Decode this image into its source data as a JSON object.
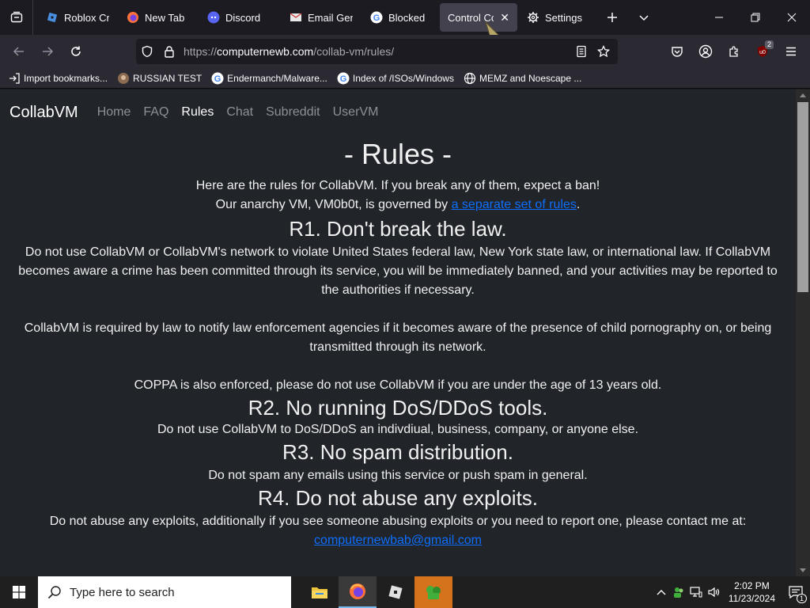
{
  "browser": {
    "tabs": [
      {
        "label": "Roblox Cre",
        "icon": "roblox-icon"
      },
      {
        "label": "New Tab",
        "icon": "firefox-icon"
      },
      {
        "label": "Discord",
        "icon": "discord-icon"
      },
      {
        "label": "Email Gene",
        "icon": "email-icon"
      },
      {
        "label": "Blocked",
        "icon": "google-icon"
      },
      {
        "label": "Control Co",
        "icon": "tab-icon",
        "active": true
      },
      {
        "label": "Settings",
        "icon": "gear-icon"
      }
    ],
    "url_prefix": "https://",
    "url_host": "computernewb.com",
    "url_path": "/collab-vm/rules/",
    "extension_badge": "2",
    "bookmarks": [
      {
        "label": "Import bookmarks...",
        "icon": "import-icon"
      },
      {
        "label": "RUSSIAN TEST",
        "icon": "bookmark-image-icon"
      },
      {
        "label": "Endermanch/Malware...",
        "icon": "google-icon"
      },
      {
        "label": "Index of /ISOs/Windows",
        "icon": "google-icon"
      },
      {
        "label": "MEMZ and Noescape ...",
        "icon": "globe-icon"
      }
    ]
  },
  "site": {
    "brand": "CollabVM",
    "nav": [
      "Home",
      "FAQ",
      "Rules",
      "Chat",
      "Subreddit",
      "UserVM"
    ],
    "active_nav": "Rules"
  },
  "content": {
    "title": "- Rules -",
    "intro": "Here are the rules for CollabVM. If you break any of them, expect a ban!",
    "anarchy_prefix": "Our anarchy VM, VM0b0t, is governed by ",
    "anarchy_link": "a separate set of rules",
    "anarchy_suffix": ".",
    "r1_title": "R1. Don't break the law.",
    "r1_p1": "Do not use CollabVM or CollabVM's network to violate United States federal law, New York state law, or international law. If CollabVM becomes aware a crime has been committed through its service, you will be immediately banned, and your activities may be reported to the authorities if necessary.",
    "r1_p2": "CollabVM is required by law to notify law enforcement agencies if it becomes aware of the presence of child pornography on, or being transmitted through its network.",
    "r1_p3": "COPPA is also enforced, please do not use CollabVM if you are under the age of 13 years old.",
    "r2_title": "R2. No running DoS/DDoS tools.",
    "r2_p": "Do not use CollabVM to DoS/DDoS an indivdiual, business, company, or anyone else.",
    "r3_title": "R3. No spam distribution.",
    "r3_p": "Do not spam any emails using this service or push spam in general.",
    "r4_title": "R4. Do not abuse any exploits.",
    "r4_p": "Do not abuse any exploits, additionally if you see someone abusing exploits or you need to report one, please contact me at:",
    "r4_email": "computernewbab@gmail.com"
  },
  "taskbar": {
    "search_placeholder": "Type here to search",
    "time": "2:02 PM",
    "date": "11/23/2024",
    "notification_count": "1"
  },
  "colors": {
    "page_bg": "#212529",
    "link": "#0d6efd",
    "browser_chrome": "#2b2a33"
  }
}
